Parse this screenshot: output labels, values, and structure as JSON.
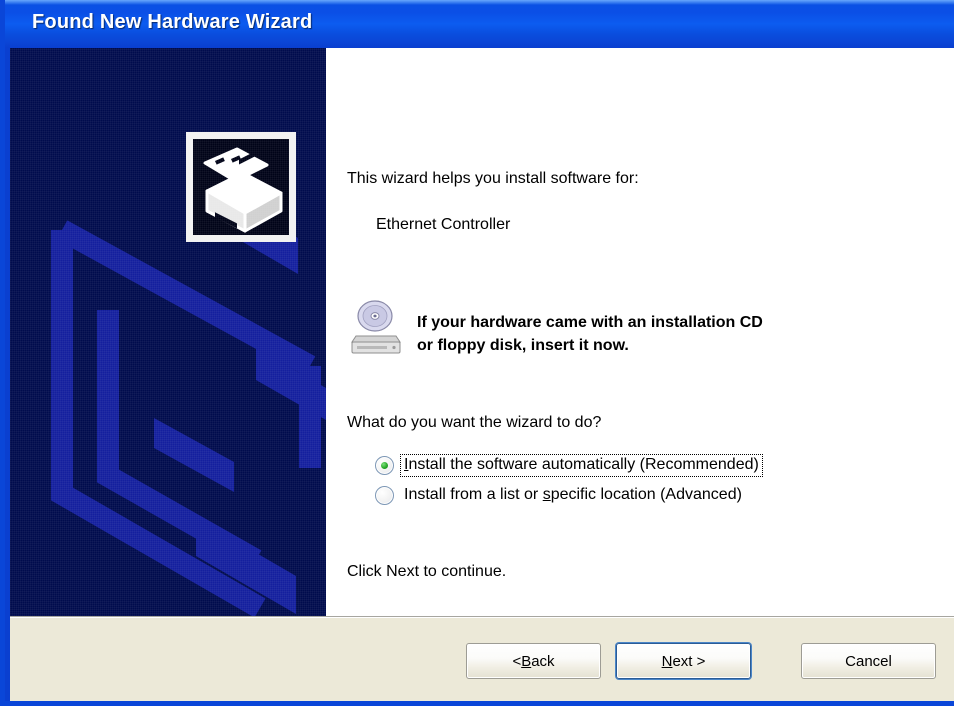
{
  "window": {
    "title": "Found New Hardware Wizard",
    "titlebar_color": "#0a50e4",
    "frame_color": "#0a46d8"
  },
  "sidepanel": {
    "background_color": "#000b4d",
    "watermark_color": "#141f9e",
    "icon_name": "hardware-card-install-icon",
    "icon_frame_color": "#f2f2f2"
  },
  "content": {
    "intro_text": "This wizard helps you install software for:",
    "device_name": "Ethernet Controller",
    "cd_notice": {
      "icon_name": "cd-drive-icon",
      "line1": "If your hardware came with an installation CD",
      "line2": "or floppy disk, insert it now."
    },
    "question_text": "What do you want the wizard to do?",
    "radio_options": [
      {
        "label_prefix": "",
        "accelerator": "I",
        "label_suffix": "nstall the software automatically (Recommended)",
        "selected": true,
        "focused": true
      },
      {
        "label_prefix": "Install from a list or ",
        "accelerator": "s",
        "label_suffix": "pecific location (Advanced)",
        "selected": false,
        "focused": false
      }
    ],
    "footer_text": "Click Next to continue."
  },
  "footer": {
    "background_color": "#ece9d8",
    "buttons": [
      {
        "prefix": "< ",
        "accelerator": "B",
        "suffix": "ack",
        "default": false
      },
      {
        "prefix": "",
        "accelerator": "N",
        "suffix": "ext >",
        "default": true
      },
      {
        "prefix": "Cancel",
        "accelerator": "",
        "suffix": "",
        "default": false
      }
    ]
  }
}
